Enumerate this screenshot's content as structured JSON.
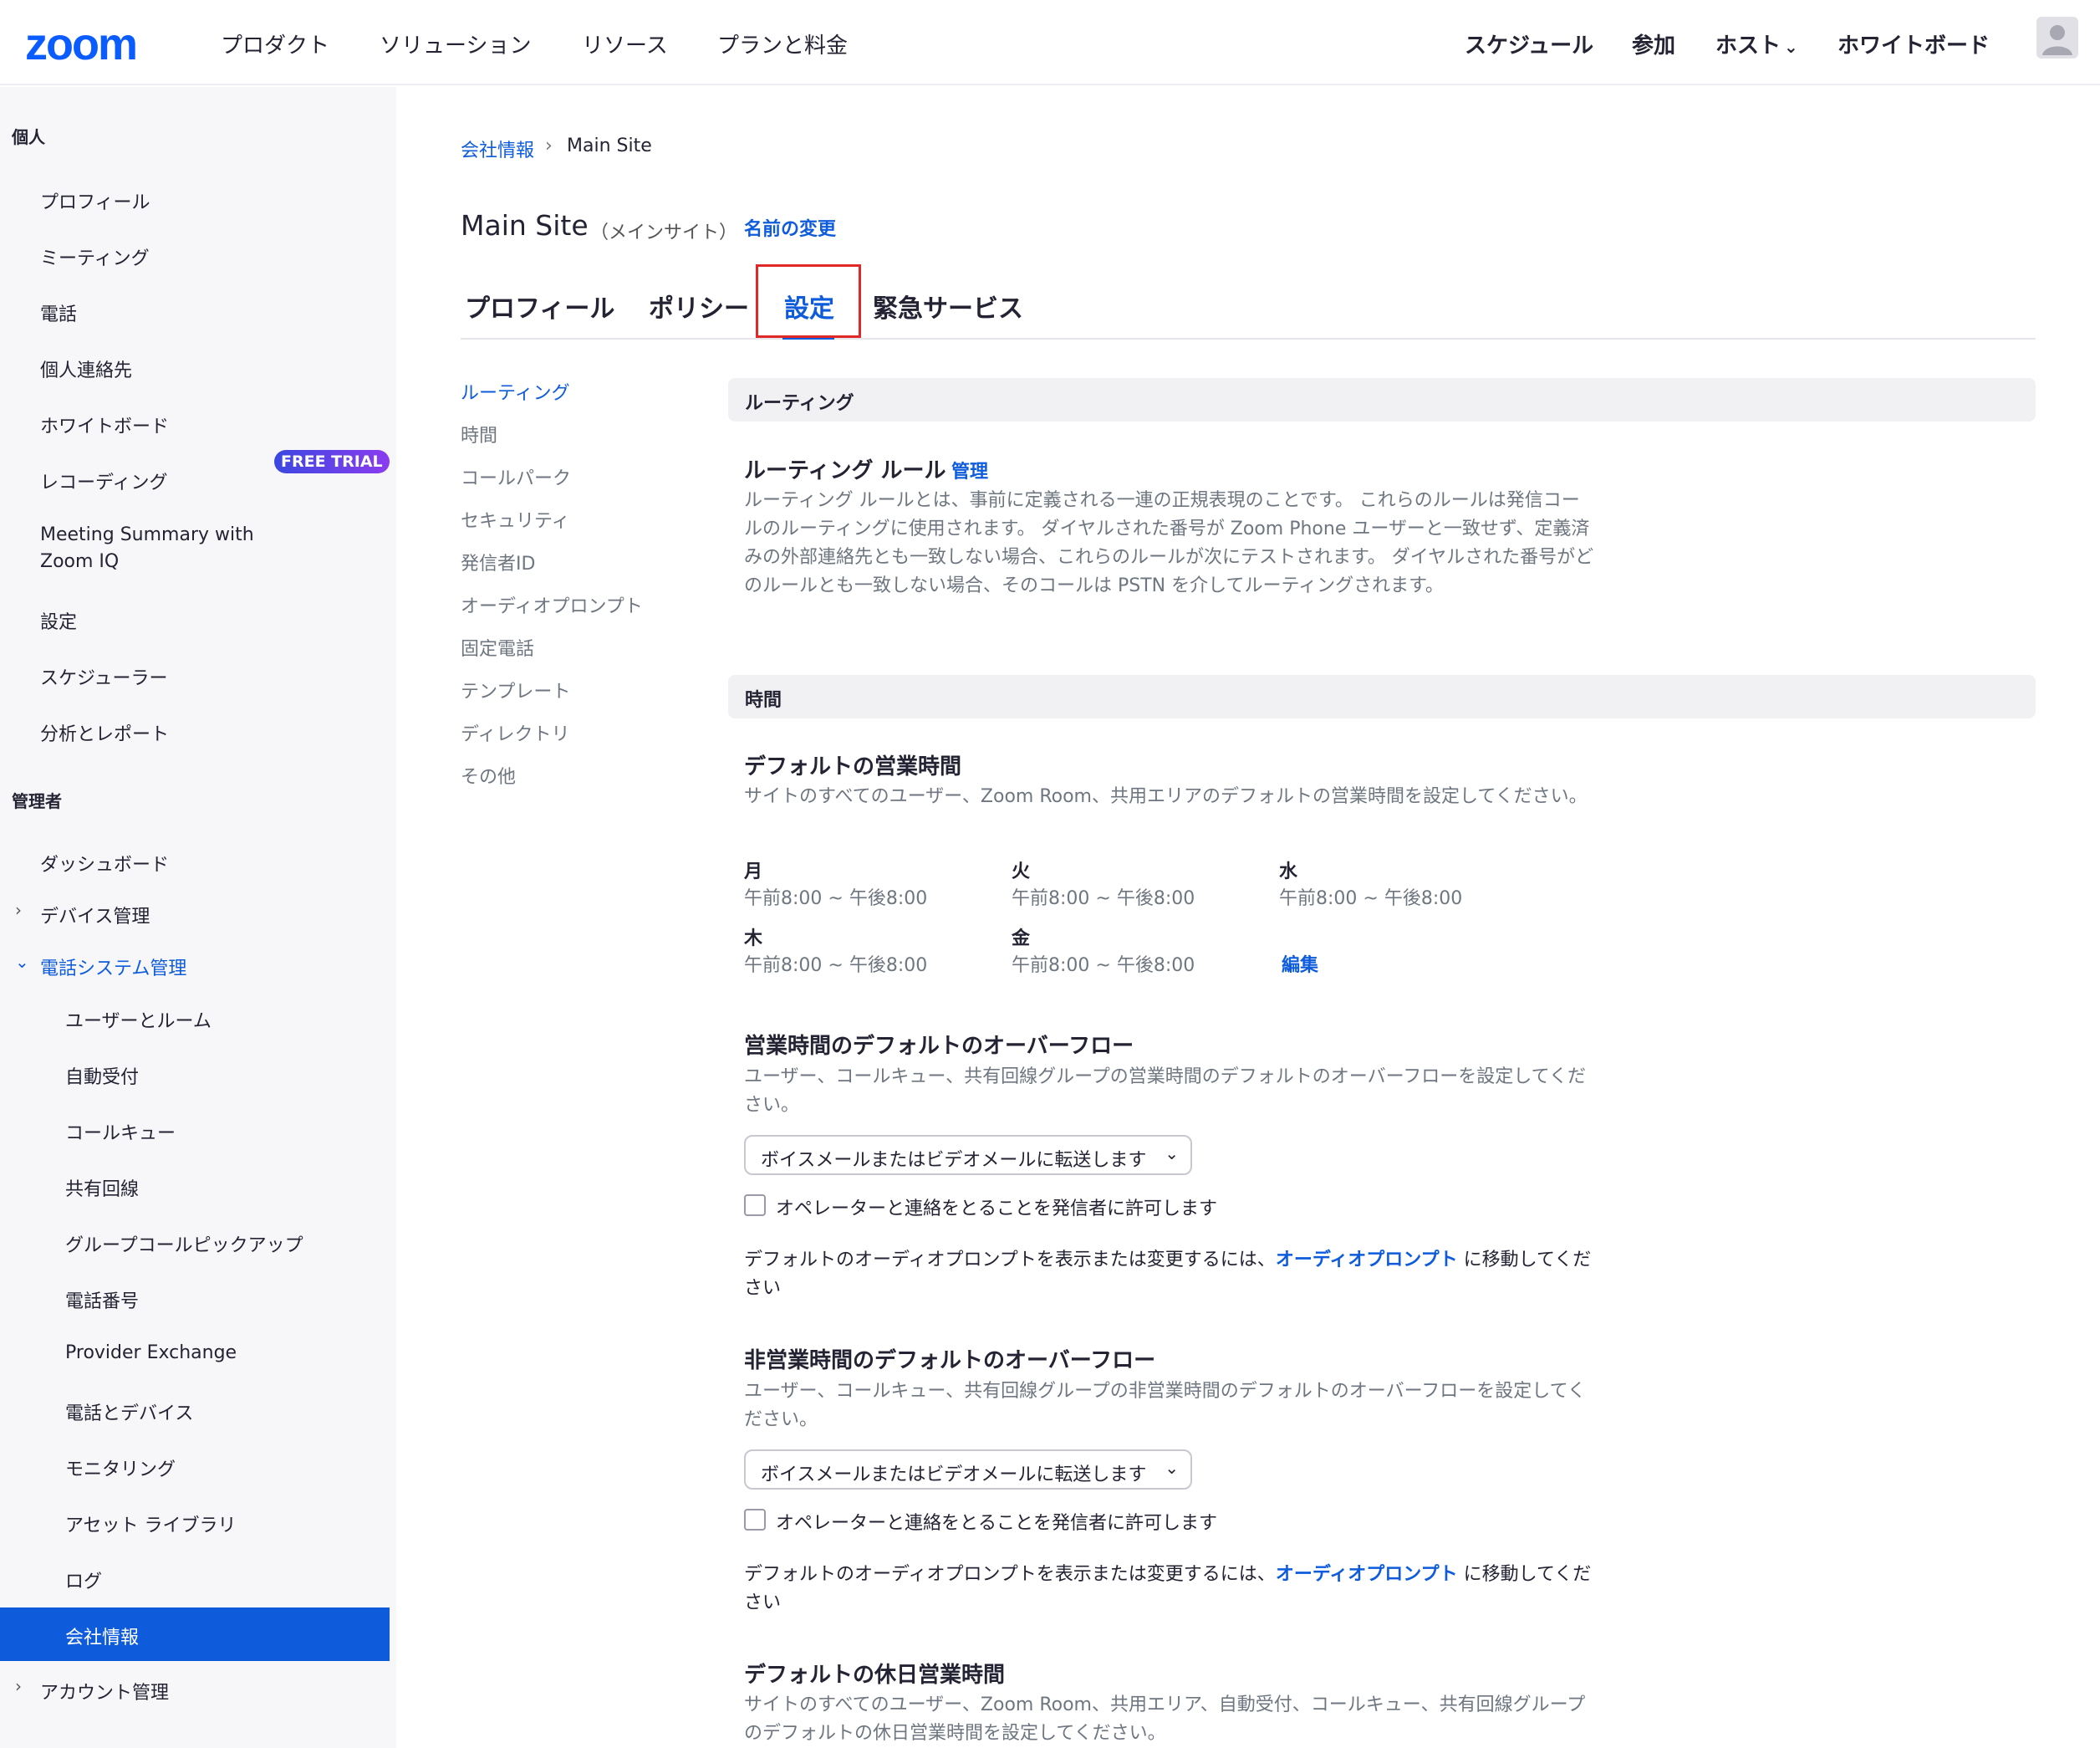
{
  "header": {
    "logo": "zoom",
    "nav": [
      "プロダクト",
      "ソリューション",
      "リソース",
      "プランと料金"
    ],
    "right_nav": [
      "スケジュール",
      "参加",
      "ホスト",
      "ホワイトボード"
    ],
    "host_chevron": "⌄"
  },
  "sidebar": {
    "personal_label": "個人",
    "personal_items": [
      "プロフィール",
      "ミーティング",
      "電話",
      "個人連絡先",
      "ホワイトボード",
      "レコーディング",
      "Meeting Summary with",
      "Zoom IQ",
      "設定",
      "スケジューラー",
      "分析とレポート"
    ],
    "free_trial": "FREE TRIAL",
    "admin_label": "管理者",
    "admin_items": [
      "ダッシュボード",
      "デバイス管理",
      "電話システム管理"
    ],
    "phone_sub": [
      "ユーザーとルーム",
      "自動受付",
      "コールキュー",
      "共有回線",
      "グループコールピックアップ",
      "電話番号",
      "Provider Exchange",
      "電話とデバイス",
      "モニタリング",
      "アセット ライブラリ",
      "ログ",
      "会社情報"
    ],
    "account": "アカウント管理"
  },
  "breadcrumb": {
    "parent": "会社情報",
    "sep": "›",
    "current": "Main Site"
  },
  "title": {
    "name": "Main Site",
    "sub": "（メインサイト）",
    "rename": "名前の変更"
  },
  "tabs": [
    "プロフィール",
    "ポリシー",
    "設定",
    "緊急サービス"
  ],
  "left_nav": [
    "ルーティング",
    "時間",
    "コールパーク",
    "セキュリティ",
    "発信者ID",
    "オーディオプロンプト",
    "固定電話",
    "テンプレート",
    "ディレクトリ",
    "その他"
  ],
  "routing": {
    "section": "ルーティング",
    "rule_title": "ルーティング ルール",
    "manage": "管理",
    "desc": "ルーティング ルールとは、事前に定義される一連の正規表現のことです。 これらのルールは発信コールのルーティングに使用されます。 ダイヤルされた番号が Zoom Phone ユーザーと一致せず、定義済みの外部連絡先とも一致しない場合、これらのルールが次にテストされます。 ダイヤルされた番号がどのルールとも一致しない場合、そのコールは PSTN を介してルーティングされます。"
  },
  "hours": {
    "section": "時間",
    "default_title": "デフォルトの営業時間",
    "default_desc": "サイトのすべてのユーザー、Zoom Room、共用エリアのデフォルトの営業時間を設定してください。",
    "days": [
      {
        "day": "月",
        "time": "午前8:00 ~ 午後8:00"
      },
      {
        "day": "火",
        "time": "午前8:00 ~ 午後8:00"
      },
      {
        "day": "水",
        "time": "午前8:00 ~ 午後8:00"
      },
      {
        "day": "木",
        "time": "午前8:00 ~ 午後8:00"
      },
      {
        "day": "金",
        "time": "午前8:00 ~ 午後8:00"
      }
    ],
    "edit": "編集",
    "overflow_title": "営業時間のデフォルトのオーバーフロー",
    "overflow_desc": "ユーザー、コールキュー、共有回線グループの営業時間のデフォルトのオーバーフローを設定してください。",
    "overflow_select": "ボイスメールまたはビデオメールに転送します",
    "operator_label": "オペレーターと連絡をとることを発信者に許可します",
    "prompt_pre": "デフォルトのオーディオプロンプトを表示または変更するには、",
    "prompt_link": "オーディオプロンプト",
    "prompt_post": " に移動してください",
    "after_title": "非営業時間のデフォルトのオーバーフロー",
    "after_desc": "ユーザー、コールキュー、共有回線グループの非営業時間のデフォルトのオーバーフローを設定してください。",
    "after_select": "ボイスメールまたはビデオメールに転送します",
    "after_operator": "オペレーターと連絡をとることを発信者に許可します",
    "after_prompt_pre": "デフォルトのオーディオプロンプトを表示または変更するには、",
    "after_prompt_link": "オーディオプロンプト",
    "after_prompt_post": " に移動してください",
    "holiday_title": "デフォルトの休日営業時間",
    "holiday_desc": "サイトのすべてのユーザー、Zoom Room、共用エリア、自動受付、コールキュー、共有回線グループのデフォルトの休日営業時間を設定してください。"
  },
  "colors": {
    "accent": "#0e5cdc",
    "brand": "#0b5cff",
    "highlight_box": "#e02828"
  },
  "icons": [
    "chevron-down-icon",
    "chevron-right-icon",
    "user-avatar-icon"
  ]
}
